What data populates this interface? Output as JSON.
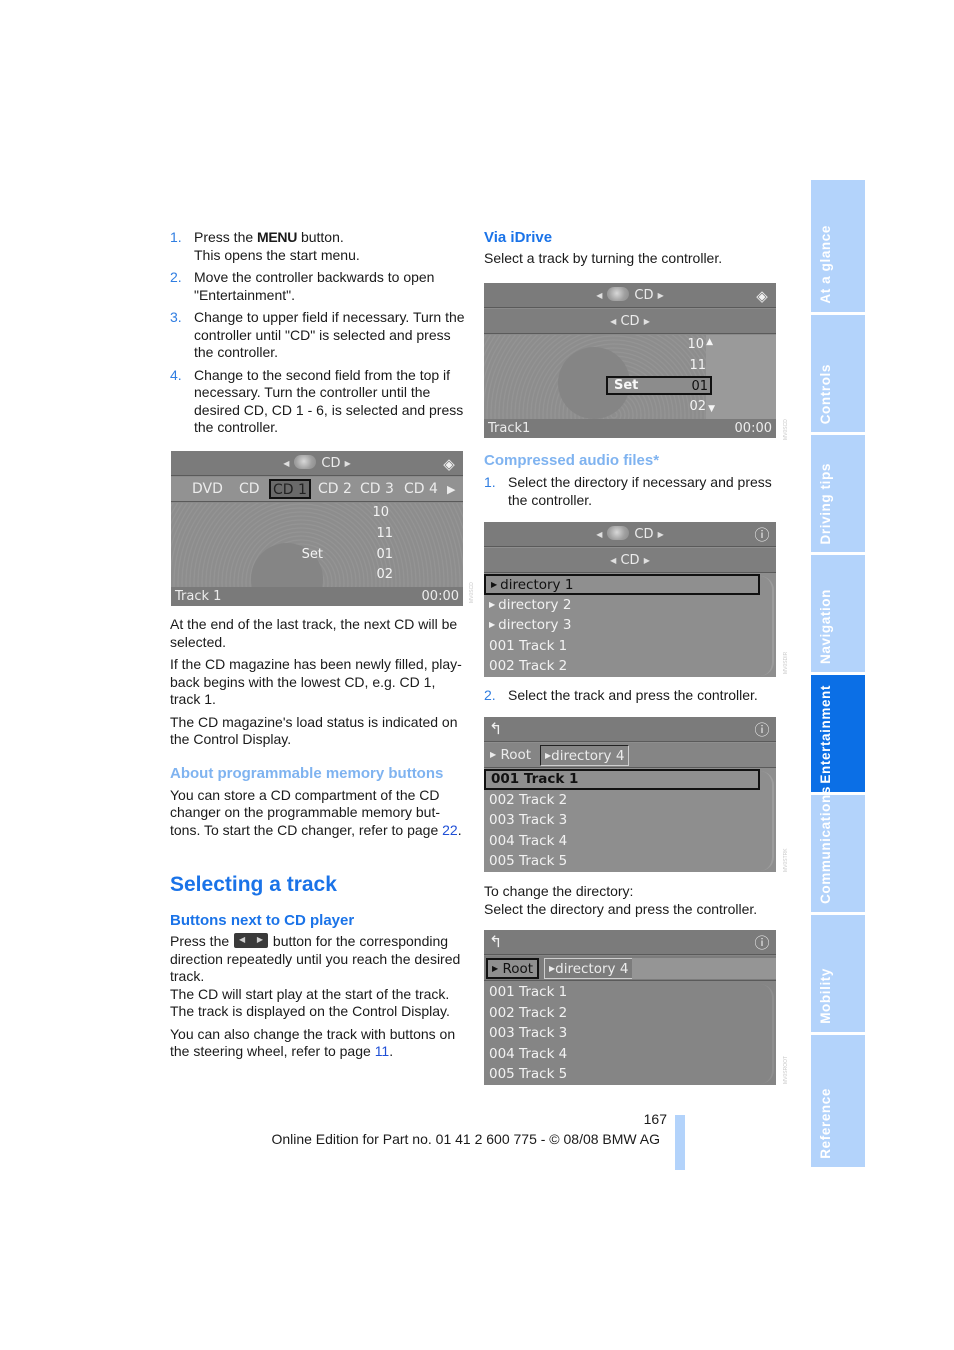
{
  "left": {
    "steps": [
      {
        "num": "1.",
        "pre": "Press the ",
        "key": "MENU",
        "post": " button.",
        "line2": "This opens the start menu."
      },
      {
        "num": "2.",
        "text": "Move the controller backwards to open \"Entertainment\"."
      },
      {
        "num": "3.",
        "text": "Change to upper field if necessary. Turn the controller until \"CD\" is selected and press the controller."
      },
      {
        "num": "4.",
        "text": "Change to the second field from the top if necessary. Turn the controller until the desired CD, CD 1 - 6, is selected and press the controller."
      }
    ],
    "screen1": {
      "top_title": "CD",
      "tabs": [
        "DVD",
        "CD",
        "CD 1",
        "CD 2",
        "CD 3",
        "CD 4"
      ],
      "selected_tab": "CD 1",
      "wheel": [
        "10",
        "11",
        "01",
        "02"
      ],
      "set_label": "Set",
      "track": "Track 1",
      "time": "00:00"
    },
    "para1": "At the end of the last track, the next CD will be selected.",
    "para2": "If the CD magazine has been newly filled, play-back begins with the lowest CD, e.g. CD 1, track 1.",
    "para3": "The CD magazine's load status is indicated on the Control Display.",
    "memory_heading": "About programmable memory buttons",
    "memory_text": "You can store a CD compartment of the CD changer on the programmable memory but-tons. To start the CD changer, refer to page ",
    "memory_link": "22",
    "section_title": "Selecting a track",
    "buttons_heading": "Buttons next to CD player",
    "buttons_pre": "Press the ",
    "buttons_post": " button for the corresponding direction repeatedly until you reach the desired track.",
    "buttons_line2": "The CD will start play at the start of the track.",
    "buttons_line3": "The track is displayed on the Control Display.",
    "steering_text": "You can also change the track with buttons on the steering wheel, refer to page ",
    "steering_link": "11"
  },
  "right": {
    "idrive_heading": "Via iDrive",
    "idrive_text": "Select a track by turning the controller.",
    "screen2": {
      "top_title": "CD",
      "sub_title": "CD",
      "wheel": [
        "10",
        "11",
        "01",
        "02"
      ],
      "set_label": "Set",
      "track": "Track1",
      "time": "00:00"
    },
    "compressed_heading": "Compressed audio files*",
    "step1": {
      "num": "1.",
      "text": "Select the directory if necessary and press the controller."
    },
    "screen3": {
      "top_title": "CD",
      "sub_title": "CD",
      "rows": [
        "directory 1",
        "directory 2",
        "directory 3",
        "001 Track  1",
        "002 Track  2"
      ]
    },
    "step2": {
      "num": "2.",
      "text": "Select the track and press the controller."
    },
    "screen4": {
      "crumb_root": "Root",
      "crumb_dir": "directory 4",
      "rows": [
        "001 Track  1",
        "002 Track  2",
        "003 Track  3",
        "004 Track  4",
        "005 Track  5"
      ]
    },
    "change_dir_1": "To change the directory:",
    "change_dir_2": "Select the directory and press the controller.",
    "screen5": {
      "crumb_root": "Root",
      "crumb_dir": "directory 4",
      "rows": [
        "001 Track  1",
        "002 Track  2",
        "003 Track  3",
        "004 Track  4",
        "005 Track  5"
      ]
    }
  },
  "side_tabs": [
    {
      "label": "At a glance",
      "active": false
    },
    {
      "label": "Controls",
      "active": false
    },
    {
      "label": "Driving tips",
      "active": false
    },
    {
      "label": "Navigation",
      "active": false
    },
    {
      "label": "Entertainment",
      "active": true
    },
    {
      "label": "Communications",
      "active": false
    },
    {
      "label": "Mobility",
      "active": false
    },
    {
      "label": "Reference",
      "active": false
    }
  ],
  "footer": {
    "page_number": "167",
    "edition": "Online Edition for Part no. 01 41 2 600 775 - © 08/08 BMW AG"
  },
  "colors": {
    "heading_blue": "#1a73e8",
    "heading_light_blue": "#7fb3f0",
    "tab_light": "#b3d3fb",
    "tab_active": "#0b6fe6",
    "link": "#1f4fd6"
  }
}
